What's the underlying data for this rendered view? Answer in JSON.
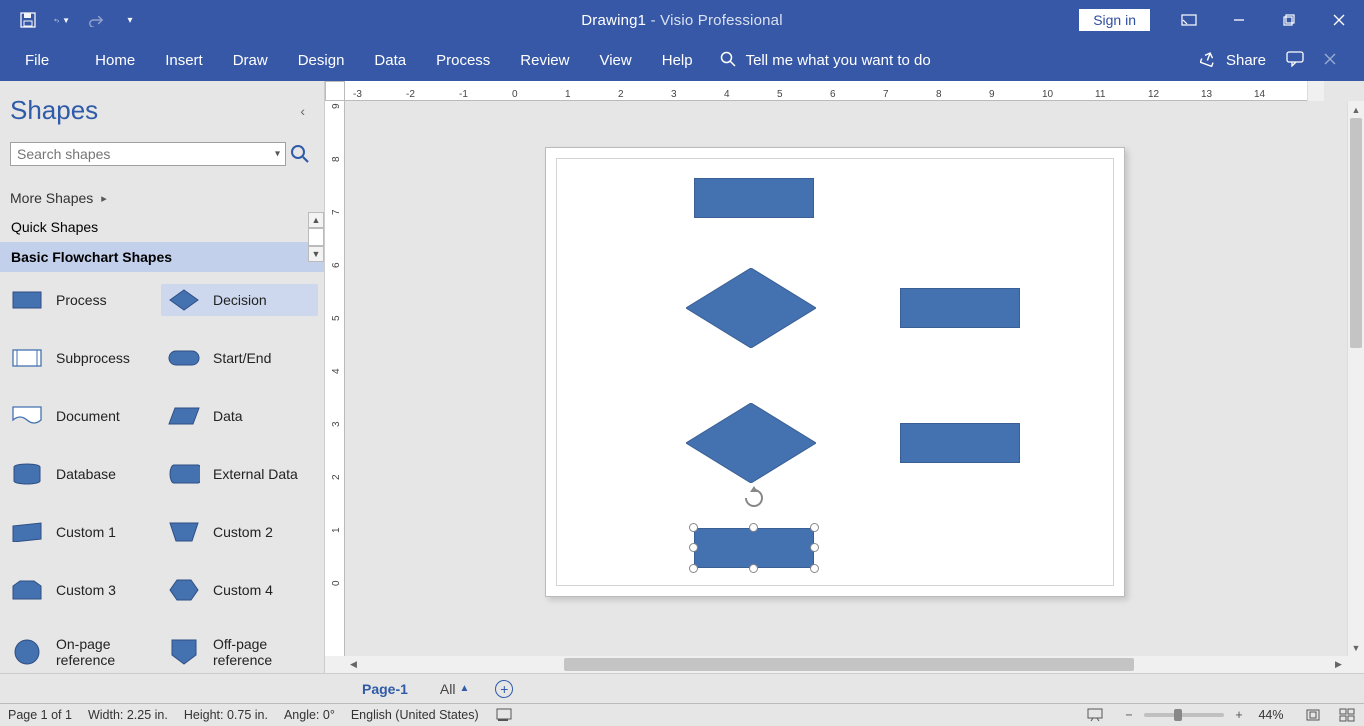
{
  "title": {
    "document": "Drawing1",
    "sep": "  -  ",
    "app": "Visio Professional"
  },
  "qat": {
    "save_tooltip": "Save",
    "undo_tooltip": "Undo",
    "redo_tooltip": "Redo"
  },
  "signin": "Sign in",
  "ribbon": {
    "file": "File",
    "home": "Home",
    "insert": "Insert",
    "draw": "Draw",
    "design": "Design",
    "data": "Data",
    "process": "Process",
    "review": "Review",
    "view": "View",
    "help": "Help",
    "tellme_placeholder": "Tell me what you want to do",
    "share": "Share"
  },
  "shapesPane": {
    "title": "Shapes",
    "search_placeholder": "Search shapes",
    "more": "More Shapes",
    "stencils": [
      "Quick Shapes",
      "Basic Flowchart Shapes"
    ],
    "active_stencil": "Basic Flowchart Shapes",
    "shapes": [
      {
        "id": "process",
        "label": "Process"
      },
      {
        "id": "decision",
        "label": "Decision"
      },
      {
        "id": "subprocess",
        "label": "Subprocess"
      },
      {
        "id": "startend",
        "label": "Start/End"
      },
      {
        "id": "document",
        "label": "Document"
      },
      {
        "id": "data",
        "label": "Data"
      },
      {
        "id": "database",
        "label": "Database"
      },
      {
        "id": "externaldata",
        "label": "External Data"
      },
      {
        "id": "custom1",
        "label": "Custom 1"
      },
      {
        "id": "custom2",
        "label": "Custom 2"
      },
      {
        "id": "custom3",
        "label": "Custom 3"
      },
      {
        "id": "custom4",
        "label": "Custom 4"
      },
      {
        "id": "onpageref",
        "label": "On-page reference"
      },
      {
        "id": "offpageref",
        "label": "Off-page reference"
      }
    ]
  },
  "hruler": [
    "-3",
    "-2",
    "-1",
    "0",
    "1",
    "2",
    "3",
    "4",
    "5",
    "6",
    "7",
    "8",
    "9",
    "10",
    "11",
    "12",
    "13",
    "14"
  ],
  "vruler": [
    "9",
    "8",
    "7",
    "6",
    "5",
    "4",
    "3",
    "2",
    "1",
    "0"
  ],
  "pageTabs": {
    "page1": "Page-1",
    "all": "All"
  },
  "status": {
    "page": "Page 1 of 1",
    "width": "Width: 2.25 in.",
    "height": "Height: 0.75 in.",
    "angle": "Angle: 0°",
    "lang": "English (United States)",
    "zoom": "44%"
  },
  "colors": {
    "accent": "#3758a6",
    "shapeFill": "#4472b0"
  }
}
